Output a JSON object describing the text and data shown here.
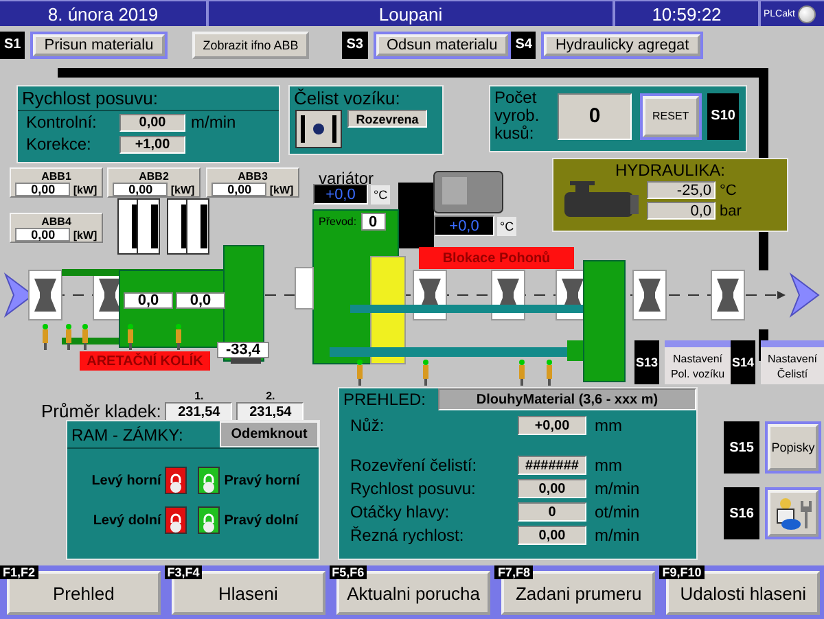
{
  "header": {
    "date": "8. února 2019",
    "title": "Loupani",
    "time": "10:59:22",
    "plc_label": "PLCakt",
    "plc_on": true
  },
  "toolbar": [
    {
      "key": "S1",
      "label": "Prisun materialu"
    },
    {
      "label": "Zobrazit ifno ABB"
    },
    {
      "key": "S3",
      "label": "Odsun materialu"
    },
    {
      "key": "S4",
      "label": "Hydraulicky agregat"
    }
  ],
  "feed_speed": {
    "title": "Rychlost posuvu:",
    "rows": [
      {
        "label": "Kontrolní:",
        "value": "0,00",
        "unit": "m/min"
      },
      {
        "label": "Korekce:",
        "value": "+1,00"
      }
    ]
  },
  "jaw": {
    "title": "Čelist vozíku:",
    "status": "Rozevrena"
  },
  "count": {
    "label": "Počet vyrob. kusů:",
    "value": "0",
    "button": "RESET",
    "key": "S10"
  },
  "hydraulics": {
    "title": "HYDRAULIKA:",
    "temperature": "-25,0",
    "temperature_unit": "°C",
    "pressure": "0,0",
    "pressure_unit": "bar"
  },
  "drives": [
    {
      "name": "ABB1",
      "value": "0,00",
      "unit": "[kW]"
    },
    {
      "name": "ABB2",
      "value": "0,00",
      "unit": "[kW]"
    },
    {
      "name": "ABB3",
      "value": "0,00",
      "unit": "[kW]"
    },
    {
      "name": "ABB4",
      "value": "0,00",
      "unit": "[kW]"
    }
  ],
  "variator": {
    "label": "variátor",
    "temperature": "+0,0",
    "unit": "°C",
    "ratio_label": "Převod:",
    "ratio": "0"
  },
  "motor": {
    "temperature": "+0,0",
    "unit": "°C"
  },
  "alarms": {
    "drive_block": "Blokace Pohonů",
    "locking_pin": "ARETAČNÍ KOLÍK"
  },
  "roller_readouts": [
    "0,0",
    "0,0",
    "-33,4"
  ],
  "side_buttons": [
    {
      "key": "S13",
      "label": "Nastavení Pol. vozíku"
    },
    {
      "key": "S14",
      "label": "Nastavení Čelistí"
    },
    {
      "key": "S15",
      "label": "Popisky"
    },
    {
      "key": "S16"
    }
  ],
  "diameter": {
    "label": "Průměr kladek:",
    "values": [
      {
        "head": "1.",
        "value": "231,54"
      },
      {
        "head": "2.",
        "value": "231,54"
      }
    ]
  },
  "locks": {
    "title": "RAM - ZÁMKY:",
    "button": "Odemknout",
    "items": [
      {
        "label": "Levý horní",
        "locked": true
      },
      {
        "label": "Pravý horní",
        "locked": false
      },
      {
        "label": "Levý dolní",
        "locked": true
      },
      {
        "label": "Pravý dolní",
        "locked": false
      }
    ]
  },
  "overview": {
    "title": "PREHLED:",
    "material": "DlouhyMaterial (3,6 - xxx m)",
    "rows": [
      {
        "label": "Nůž:",
        "value": "+0,00",
        "unit": "mm"
      },
      {
        "label": "Rozevření čelistí:",
        "value": "#######",
        "unit": "mm"
      },
      {
        "label": "Rychlost posuvu:",
        "value": "0,00",
        "unit": "m/min"
      },
      {
        "label": "Otáčky hlavy:",
        "value": "0",
        "unit": "ot/min"
      },
      {
        "label": "Řezná rychlost:",
        "value": "0,00",
        "unit": "m/min"
      }
    ]
  },
  "footer": [
    {
      "key": "F1,F2",
      "label": "Prehled"
    },
    {
      "key": "F3,F4",
      "label": "Hlaseni"
    },
    {
      "key": "F5,F6",
      "label": "Aktualni porucha"
    },
    {
      "key": "F7,F8",
      "label": "Zadani prumeru"
    },
    {
      "key": "F9,F10",
      "label": "Udalosti hlaseni"
    }
  ]
}
